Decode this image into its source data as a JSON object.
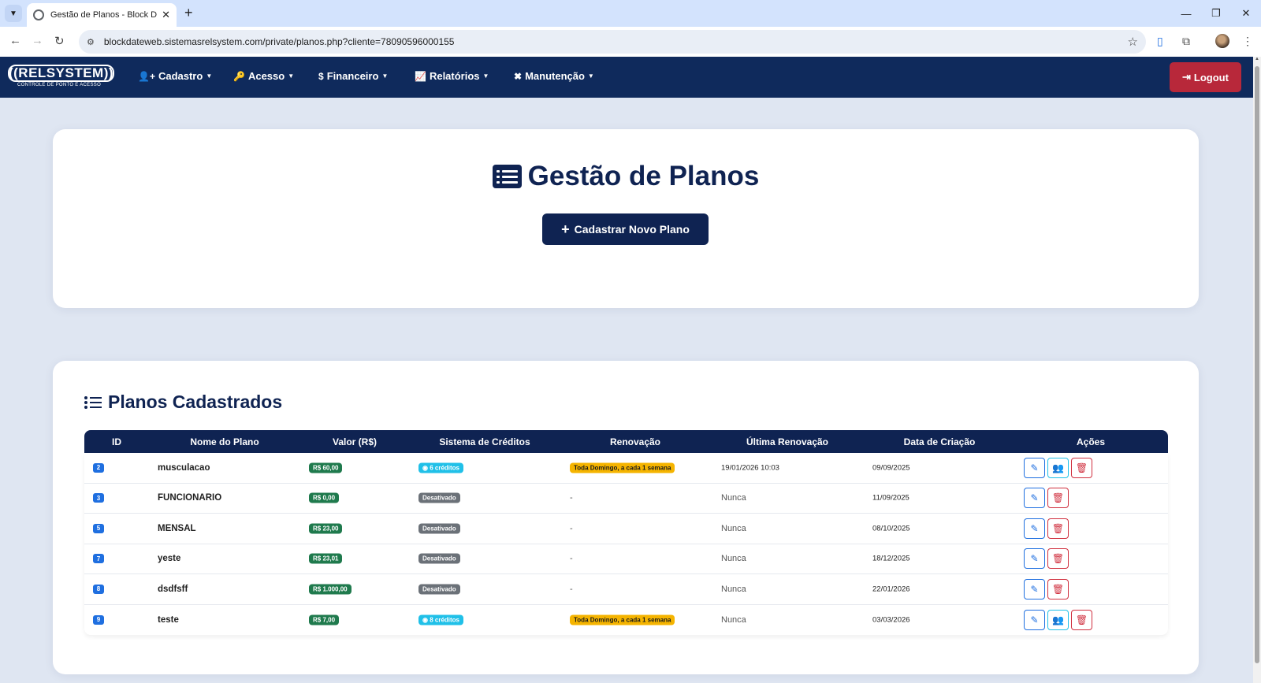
{
  "browser": {
    "tab_title": "Gestão de Planos - Block Date W",
    "url": "blockdateweb.sistemasrelsystem.com/private/planos.php?cliente=78090596000155"
  },
  "brand": {
    "logo_text": "((RELSYSTEM))",
    "logo_subtext": "CONTROLE DE PONTO E ACESSO"
  },
  "nav": {
    "items": [
      {
        "label": "Cadastro",
        "icon": "user-plus-icon"
      },
      {
        "label": "Acesso",
        "icon": "key-icon"
      },
      {
        "label": "Financeiro",
        "icon": "dollar-icon"
      },
      {
        "label": "Relatórios",
        "icon": "chart-icon"
      },
      {
        "label": "Manutenção",
        "icon": "tools-icon"
      }
    ],
    "logout_label": "Logout"
  },
  "header": {
    "title": "Gestão de Planos",
    "new_plan_label": "Cadastrar Novo Plano"
  },
  "plans": {
    "section_title": "Planos Cadastrados",
    "columns": [
      "ID",
      "Nome do Plano",
      "Valor (R$)",
      "Sistema de Créditos",
      "Renovação",
      "Última Renovação",
      "Data de Criação",
      "Ações"
    ],
    "rows": [
      {
        "id": "2",
        "name": "musculacao",
        "value": "R$ 60,00",
        "credits": "6 créditos",
        "credits_enabled": true,
        "renewal": "Toda Domingo, a cada 1 semana",
        "last_renewal": "19/01/2026 10:03",
        "created": "09/09/2025",
        "has_users_action": true
      },
      {
        "id": "3",
        "name": "FUNCIONARIO",
        "value": "R$ 0,00",
        "credits": "Desativado",
        "credits_enabled": false,
        "renewal": "-",
        "last_renewal": "Nunca",
        "created": "11/09/2025",
        "has_users_action": false
      },
      {
        "id": "5",
        "name": "MENSAL",
        "value": "R$ 23,00",
        "credits": "Desativado",
        "credits_enabled": false,
        "renewal": "-",
        "last_renewal": "Nunca",
        "created": "08/10/2025",
        "has_users_action": false
      },
      {
        "id": "7",
        "name": "yeste",
        "value": "R$ 23,01",
        "credits": "Desativado",
        "credits_enabled": false,
        "renewal": "-",
        "last_renewal": "Nunca",
        "created": "18/12/2025",
        "has_users_action": false
      },
      {
        "id": "8",
        "name": "dsdfsff",
        "value": "R$ 1.000,00",
        "credits": "Desativado",
        "credits_enabled": false,
        "renewal": "-",
        "last_renewal": "Nunca",
        "created": "22/01/2026",
        "has_users_action": false
      },
      {
        "id": "9",
        "name": "teste",
        "value": "R$ 7,00",
        "credits": "8 créditos",
        "credits_enabled": true,
        "renewal": "Toda Domingo, a cada 1 semana",
        "last_renewal": "Nunca",
        "created": "03/03/2026",
        "has_users_action": true
      }
    ]
  },
  "colors": {
    "navy": "#0f2352",
    "nav_bg": "#0f2a5c",
    "logout": "#b8283a",
    "price_badge": "#1f7a4d",
    "credits_badge": "#20c0e8",
    "disabled_badge": "#6b7178",
    "renewal_badge": "#f5b400",
    "id_badge": "#1f6fe0"
  }
}
